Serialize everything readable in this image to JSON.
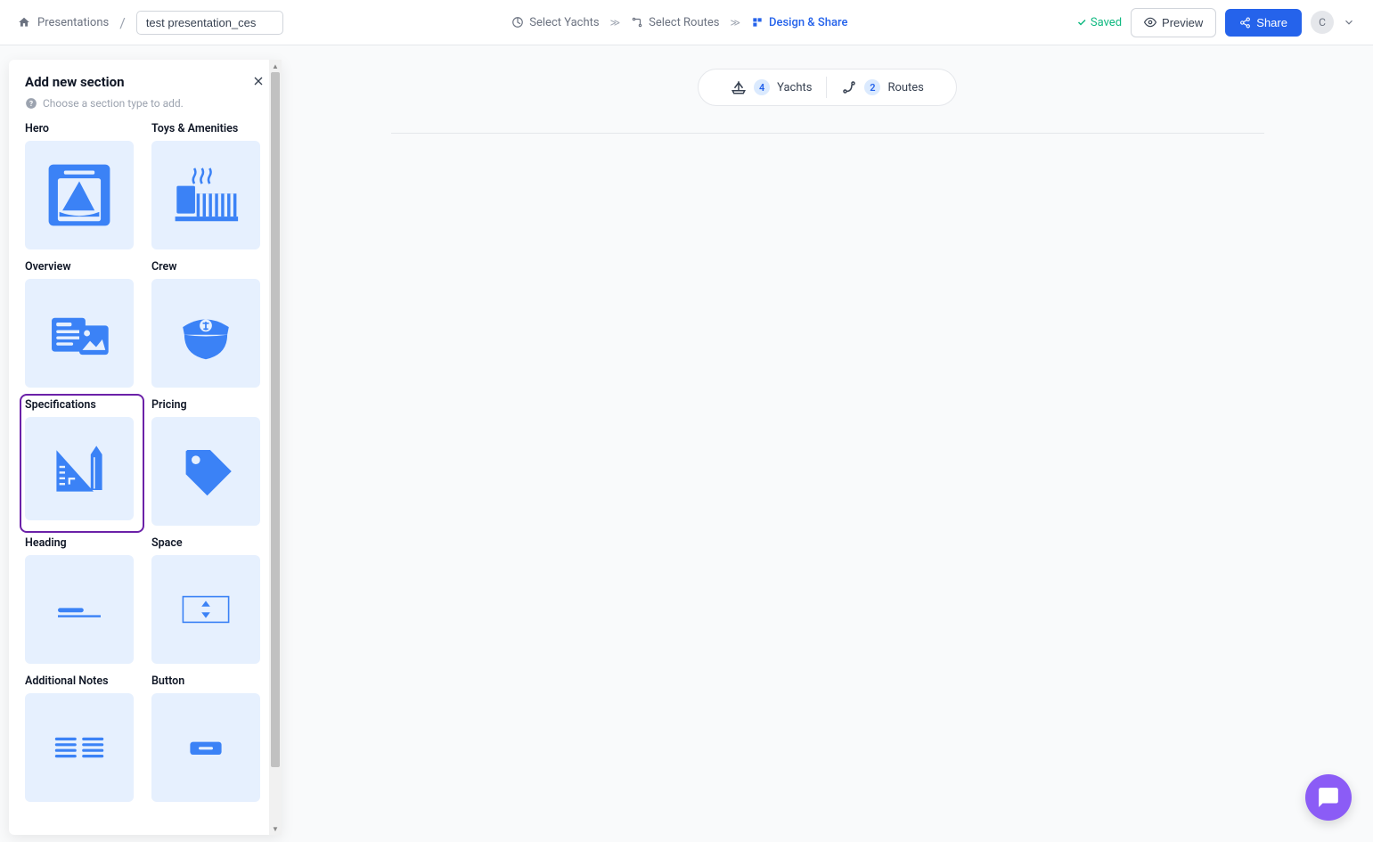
{
  "breadcrumb": {
    "home": "Presentations",
    "title": "test presentation_ces"
  },
  "steps": {
    "s1": "Select Yachts",
    "s2": "Select Routes",
    "s3": "Design & Share"
  },
  "header": {
    "saved": "Saved",
    "preview": "Preview",
    "share": "Share",
    "avatar_initial": "C"
  },
  "panel": {
    "title": "Add new section",
    "subtitle": "Choose a section type to add."
  },
  "sections": {
    "hero": "Hero",
    "toys": "Toys & Amenities",
    "overview": "Overview",
    "crew": "Crew",
    "specs": "Specifications",
    "pricing": "Pricing",
    "heading": "Heading",
    "space": "Space",
    "notes": "Additional Notes",
    "button": "Button"
  },
  "pills": {
    "yachts_count": "4",
    "yachts_label": "Yachts",
    "routes_count": "2",
    "routes_label": "Routes"
  }
}
